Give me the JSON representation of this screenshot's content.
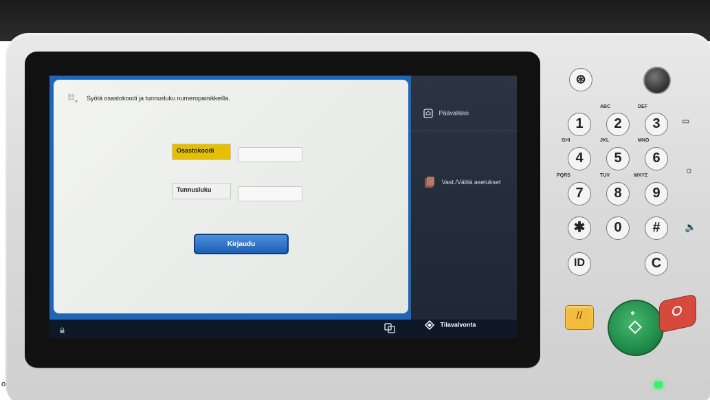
{
  "screen": {
    "instruction": "Syötä osastokoodi ja tunnusluku numeropainikkeilla.",
    "fields": {
      "department_label": "Osastokoodi",
      "pin_label": "Tunnusluku",
      "department_value": "",
      "pin_value": ""
    },
    "login_label": "Kirjaudu",
    "sidebar": {
      "home_label": "Päävalikko",
      "settings_label": "Vast./Välitä asetukset"
    },
    "bottom": {
      "status_label": "Tilavalvonta"
    }
  },
  "keypad": {
    "keys": [
      {
        "label": "1",
        "letters": ""
      },
      {
        "label": "2",
        "letters": "ABC"
      },
      {
        "label": "3",
        "letters": "DEF"
      },
      {
        "label": "4",
        "letters": "GHI"
      },
      {
        "label": "5",
        "letters": "JKL"
      },
      {
        "label": "6",
        "letters": "MNO"
      },
      {
        "label": "7",
        "letters": "PQRS"
      },
      {
        "label": "8",
        "letters": "TUV"
      },
      {
        "label": "9",
        "letters": "WXYZ"
      },
      {
        "label": "✱",
        "letters": ""
      },
      {
        "label": "0",
        "letters": ""
      },
      {
        "label": "#",
        "letters": ""
      },
      {
        "label": "ID",
        "letters": ""
      },
      {
        "label": "C",
        "letters": ""
      }
    ],
    "top_key": "⊛"
  },
  "corner_text": "o",
  "colors": {
    "accent_blue": "#1f66b9",
    "dept_label_yellow": "#e6c000",
    "start_green": "#1f8b4b",
    "stop_red": "#d64a3d"
  }
}
